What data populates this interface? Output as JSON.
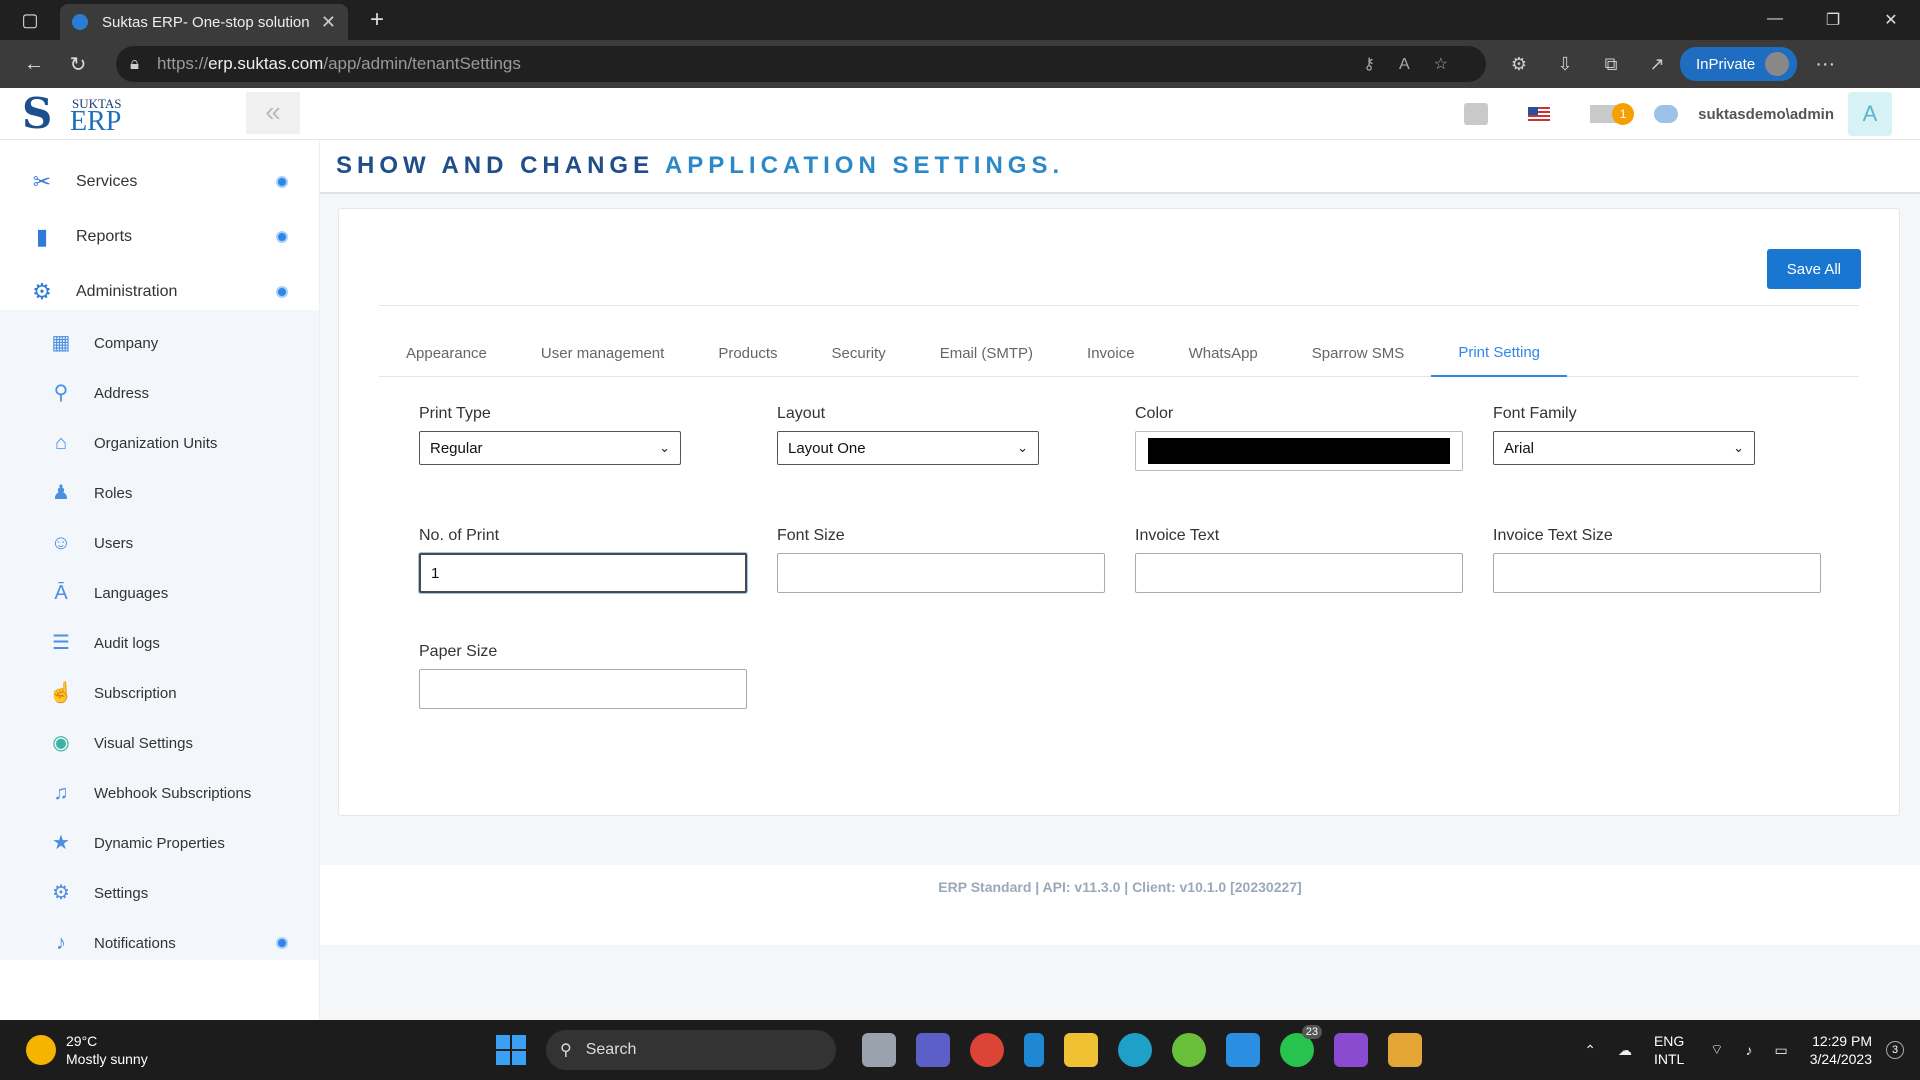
{
  "browser": {
    "tab_title": "Suktas ERP- One-stop solution",
    "url_prefix": "https://",
    "url_domain": "erp.suktas.com",
    "url_path": "/app/admin/tenantSettings",
    "inprivate_label": "InPrivate"
  },
  "header": {
    "logo_top": "SUKTAS",
    "logo_main": "ERP",
    "mail_badge": "1",
    "user": "suktasdemo\\admin",
    "avatar_letter": "A"
  },
  "sidebar": {
    "top_items": [
      {
        "label": "Services",
        "icon": "tools-icon"
      },
      {
        "label": "Reports",
        "icon": "bar-chart-icon"
      },
      {
        "label": "Administration",
        "icon": "gear-icon"
      }
    ],
    "sub_items": [
      {
        "label": "Company",
        "icon": "building-icon"
      },
      {
        "label": "Address",
        "icon": "map-pin-icon"
      },
      {
        "label": "Organization Units",
        "icon": "home-icon"
      },
      {
        "label": "Roles",
        "icon": "person-icon"
      },
      {
        "label": "Users",
        "icon": "users-icon"
      },
      {
        "label": "Languages",
        "icon": "translate-icon"
      },
      {
        "label": "Audit logs",
        "icon": "list-check-icon"
      },
      {
        "label": "Subscription",
        "icon": "hand-pointer-icon"
      },
      {
        "label": "Visual Settings",
        "icon": "eye-icon"
      },
      {
        "label": "Webhook Subscriptions",
        "icon": "bell-icon"
      },
      {
        "label": "Dynamic Properties",
        "icon": "star-icon"
      },
      {
        "label": "Settings",
        "icon": "gear-icon"
      },
      {
        "label": "Notifications",
        "icon": "bell-alert-icon"
      }
    ]
  },
  "page": {
    "title_part1": "SHOW AND CHANGE",
    "title_part2": "APPLICATION SETTINGS.",
    "save_all": "Save All",
    "tabs": [
      "Appearance",
      "User management",
      "Products",
      "Security",
      "Email (SMTP)",
      "Invoice",
      "WhatsApp",
      "Sparrow SMS",
      "Print Setting"
    ],
    "active_tab": "Print Setting"
  },
  "form": {
    "print_type_label": "Print Type",
    "print_type_value": "Regular",
    "layout_label": "Layout",
    "layout_value": "Layout One",
    "color_label": "Color",
    "color_value": "#000000",
    "font_family_label": "Font Family",
    "font_family_value": "Arial",
    "no_of_print_label": "No. of Print",
    "no_of_print_value": "1",
    "font_size_label": "Font Size",
    "font_size_value": "",
    "invoice_text_label": "Invoice Text",
    "invoice_text_value": "",
    "invoice_text_size_label": "Invoice Text Size",
    "invoice_text_size_value": "",
    "paper_size_label": "Paper Size",
    "paper_size_value": ""
  },
  "footer": {
    "version": "ERP Standard | API: v11.3.0 | Client: v10.1.0 [20230227]"
  },
  "taskbar": {
    "temp": "29°C",
    "weather": "Mostly sunny",
    "search": "Search",
    "lang1": "ENG",
    "lang2": "INTL",
    "time": "12:29 PM",
    "date": "3/24/2023",
    "notif_count": "3",
    "whatsapp_badge": "23"
  }
}
